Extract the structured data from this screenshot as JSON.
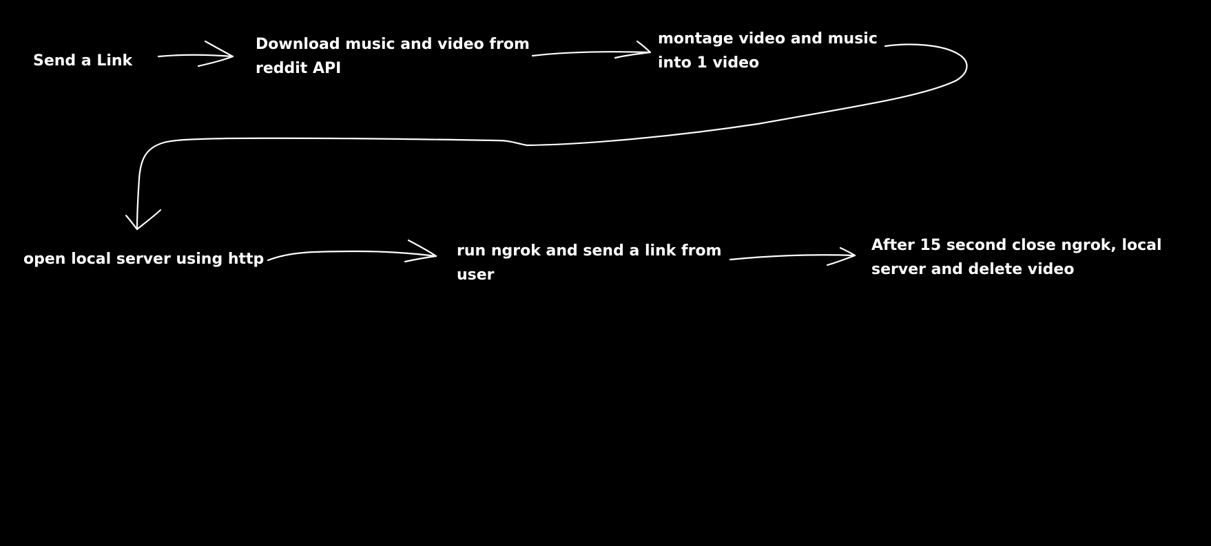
{
  "diagram": {
    "background_color": "#000000",
    "ink_color": "#ffffff",
    "steps": [
      {
        "id": "send-link",
        "lines": [
          "Send a Link"
        ]
      },
      {
        "id": "download",
        "lines": [
          "Download music and video from",
          "reddit API"
        ]
      },
      {
        "id": "montage",
        "lines": [
          "montage video and music",
          "into 1 video"
        ]
      },
      {
        "id": "open-server",
        "lines": [
          "open local server using http"
        ]
      },
      {
        "id": "run-ngrok",
        "lines": [
          "run ngrok and send a link from",
          "user"
        ]
      },
      {
        "id": "cleanup",
        "lines": [
          "After 15 second close ngrok, local",
          "server and delete video"
        ]
      }
    ],
    "connections": [
      {
        "from": "send-link",
        "to": "download"
      },
      {
        "from": "download",
        "to": "montage"
      },
      {
        "from": "montage",
        "to": "open-server"
      },
      {
        "from": "open-server",
        "to": "run-ngrok"
      },
      {
        "from": "run-ngrok",
        "to": "cleanup"
      }
    ]
  }
}
